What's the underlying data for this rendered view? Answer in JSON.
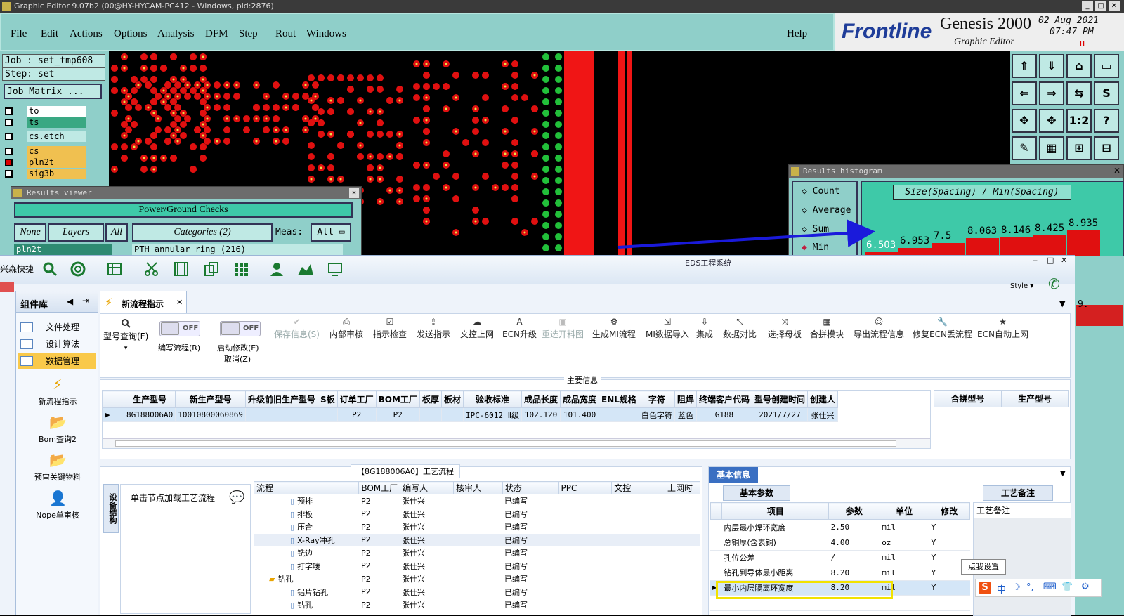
{
  "genesis": {
    "title": "Graphic Editor 9.07b2 (00@HY-HYCAM-PC412 - Windows, pid:2876)",
    "menu": [
      "File",
      "Edit",
      "Actions",
      "Options",
      "Analysis",
      "DFM",
      "Step",
      "Rout",
      "Windows"
    ],
    "help": "Help",
    "brand": "Frontline",
    "product": "Genesis 2000",
    "subtitle": "Graphic Editor",
    "date": "02 Aug 2021",
    "time": "07:47 PM",
    "job": "Job : set_tmp608",
    "step": "Step: set",
    "job_matrix": "Job Matrix ...",
    "layers": [
      {
        "name": "to",
        "color": "#ffffff"
      },
      {
        "name": "ts",
        "color": "#3aa883"
      },
      {
        "name": "cs.etch",
        "color": "#bfe9e4"
      },
      {
        "name": "cs",
        "color": "#f0c050"
      },
      {
        "name": "pln2t",
        "color": "#f0c050"
      },
      {
        "name": "sig3b",
        "color": "#f0c050"
      }
    ],
    "tool_buttons": [
      "⇑",
      "⇓",
      "⌂",
      "▭",
      "⇐",
      "⇒",
      "⇆",
      "S",
      "✥",
      "✥",
      "1:2",
      "?",
      "✎",
      "▦",
      "⊞",
      "⊟"
    ],
    "results_viewer": {
      "title": "Results viewer",
      "heading": "Power/Ground Checks",
      "none": "None",
      "layers": "Layers",
      "all": "All",
      "categories": "Categories (2)",
      "meas_label": "Meas:",
      "meas_value": "All",
      "row_layer": "pln2t",
      "row_category": "PTH annular ring (216)"
    },
    "histogram": {
      "title": "Results histogram",
      "options": [
        "Count",
        "Average",
        "Sum",
        "Min"
      ],
      "selected": "Min",
      "heading": "Size(Spacing) / Min(Spacing)",
      "values": [
        "6.503",
        "6.953",
        "7.5",
        "8.063",
        "8.146",
        "8.425",
        "8.935"
      ],
      "value_numbers": [
        6.503,
        6.953,
        7.5,
        8.063,
        8.146,
        8.425,
        8.935
      ],
      "side_label": "9."
    }
  },
  "eds": {
    "app_name": "兴森快捷",
    "title": "EDS工程系统",
    "style_label": "Style",
    "side_title": "组件库",
    "side_items": [
      "文件处理",
      "设计算法",
      "数据管理"
    ],
    "side_tools": [
      "新流程指示",
      "Bom查询2",
      "预审关键物料",
      "Nope单审核"
    ],
    "tab_label": "新流程指示",
    "toolbar": {
      "query": "型号查询(F)",
      "write_flow": "编写流程(R)",
      "start_modify": "启动修改(E)",
      "cancel": "取消(Z)",
      "toggle_off": "OFF",
      "buttons": [
        {
          "label": "保存信息(S)",
          "disabled": true
        },
        {
          "label": "内部审核",
          "disabled": false
        },
        {
          "label": "指示检查",
          "disabled": false
        },
        {
          "label": "发送指示",
          "disabled": false
        },
        {
          "label": "文控上网",
          "disabled": false
        },
        {
          "label": "ECN升级",
          "disabled": false
        },
        {
          "label": "重选开料图",
          "disabled": true
        },
        {
          "label": "生成MI流程",
          "disabled": false
        },
        {
          "label": "MI数据导入",
          "disabled": false
        },
        {
          "label": "集成",
          "disabled": false
        },
        {
          "label": "数据对比",
          "disabled": false
        },
        {
          "label": "选择母板",
          "disabled": false
        },
        {
          "label": "合拼模块",
          "disabled": false
        },
        {
          "label": "导出流程信息",
          "disabled": false
        },
        {
          "label": "修复ECN丢流程",
          "disabled": false
        },
        {
          "label": "ECN自动上网",
          "disabled": false
        }
      ]
    },
    "main_info_label": "主要信息",
    "main_table": {
      "headers": [
        "生产型号",
        "新生产型号",
        "升级前旧生产型号",
        "S板",
        "订单工厂",
        "BOM工厂",
        "板厚",
        "板材",
        "验收标准",
        "成品长度",
        "成品宽度",
        "ENL规格",
        "字符",
        "阻焊",
        "终端客户代码",
        "型号创建时间",
        "创建人"
      ],
      "row": [
        "8G188006A0",
        "10010800060869",
        "",
        "",
        "P2",
        "P2",
        "",
        "",
        "IPC-6012 Ⅱ级",
        "102.120",
        "101.400",
        "",
        "白色字符",
        "蓝色",
        "G188",
        "2021/7/27",
        "张仕兴"
      ]
    },
    "side_table_headers": [
      "合拼型号",
      "生产型号"
    ],
    "process_title": "【8G188006A0】工艺流程",
    "device_label": "设备结构",
    "load_hint": "单击节点加载工艺流程",
    "process_headers": [
      "流程",
      "BOM工厂",
      "编写人",
      "核审人",
      "状态",
      "PPC",
      "文控",
      "上网时"
    ],
    "process_rows": [
      {
        "name": "预排",
        "factory": "P2",
        "writer": "张仕兴",
        "status": "已编写",
        "indent": 1
      },
      {
        "name": "排板",
        "factory": "P2",
        "writer": "张仕兴",
        "status": "已编写",
        "indent": 1
      },
      {
        "name": "压合",
        "factory": "P2",
        "writer": "张仕兴",
        "status": "已编写",
        "indent": 1
      },
      {
        "name": "X-Ray冲孔",
        "factory": "P2",
        "writer": "张仕兴",
        "status": "已编写",
        "indent": 1
      },
      {
        "name": "铣边",
        "factory": "P2",
        "writer": "张仕兴",
        "status": "已编写",
        "indent": 1
      },
      {
        "name": "打字唛",
        "factory": "P2",
        "writer": "张仕兴",
        "status": "已编写",
        "indent": 1
      },
      {
        "name": "钻孔",
        "factory": "P2",
        "writer": "张仕兴",
        "status": "已编写",
        "indent": 0
      },
      {
        "name": "铝片钻孔",
        "factory": "P2",
        "writer": "张仕兴",
        "status": "已编写",
        "indent": 1
      },
      {
        "name": "钻孔",
        "factory": "P2",
        "writer": "张仕兴",
        "status": "已编写",
        "indent": 1
      }
    ],
    "basic_info_tab": "基本信息",
    "basic_params_tab": "基本参数",
    "process_note_tab": "工艺备注",
    "process_note_label": "工艺备注",
    "param_headers": [
      "项目",
      "参数",
      "单位",
      "修改"
    ],
    "params": [
      {
        "item": "内层最小焊环宽度",
        "value": "2.50",
        "unit": "mil",
        "mod": "Y"
      },
      {
        "item": "总铜厚(含表铜)",
        "value": "4.00",
        "unit": "oz",
        "mod": "Y"
      },
      {
        "item": "孔位公差",
        "value": "/",
        "unit": "mil",
        "mod": "Y"
      },
      {
        "item": "钻孔到导体最小距离",
        "value": "8.20",
        "unit": "mil",
        "mod": "Y"
      },
      {
        "item": "最小内层隔离环宽度",
        "value": "8.20",
        "unit": "mil",
        "mod": "Y"
      },
      {
        "item": "",
        "value": "",
        "unit": "",
        "mod": ""
      }
    ],
    "tooltip": "点我设置",
    "tray": [
      "中",
      "☽",
      "°,",
      "⌨",
      "👕",
      "⚙"
    ]
  }
}
